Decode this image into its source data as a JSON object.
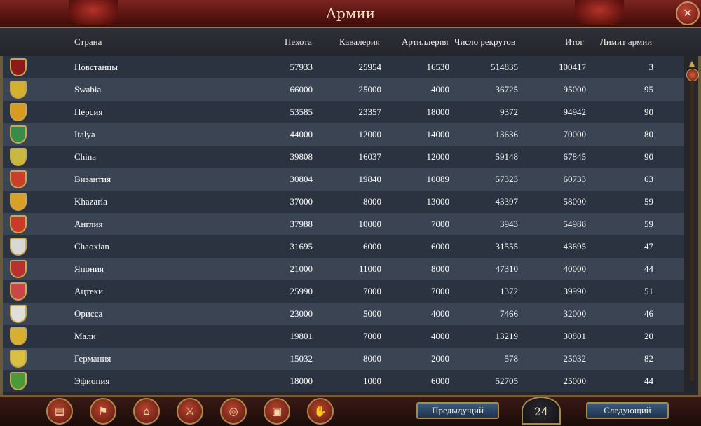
{
  "window": {
    "title": "Армии",
    "close_icon": "✕"
  },
  "columns": {
    "country": "Страна",
    "infantry": "Пехота",
    "cavalry": "Кавалерия",
    "artillery": "Артиллерия",
    "recruits": "Число рекрутов",
    "total": "Итог",
    "army_limit": "Лимит армии"
  },
  "rows": [
    {
      "country": "Повстанцы",
      "infantry": "57933",
      "cavalry": "25954",
      "artillery": "16530",
      "recruits": "514835",
      "total": "100417",
      "army_limit": "3",
      "shield_color": "#8b1a1a"
    },
    {
      "country": "Swabia",
      "infantry": "66000",
      "cavalry": "25000",
      "artillery": "4000",
      "recruits": "36725",
      "total": "95000",
      "army_limit": "95",
      "shield_color": "#d4b030"
    },
    {
      "country": "Персия",
      "infantry": "53585",
      "cavalry": "23357",
      "artillery": "18000",
      "recruits": "9372",
      "total": "94942",
      "army_limit": "90",
      "shield_color": "#d89a20"
    },
    {
      "country": "Italya",
      "infantry": "44000",
      "cavalry": "12000",
      "artillery": "14000",
      "recruits": "13636",
      "total": "70000",
      "army_limit": "80",
      "shield_color": "#3a8a4a"
    },
    {
      "country": "China",
      "infantry": "39808",
      "cavalry": "16037",
      "artillery": "12000",
      "recruits": "59148",
      "total": "67845",
      "army_limit": "90",
      "shield_color": "#c8b840"
    },
    {
      "country": "Византия",
      "infantry": "30804",
      "cavalry": "19840",
      "artillery": "10089",
      "recruits": "57323",
      "total": "60733",
      "army_limit": "63",
      "shield_color": "#c8402a"
    },
    {
      "country": "Khazaria",
      "infantry": "37000",
      "cavalry": "8000",
      "artillery": "13000",
      "recruits": "43397",
      "total": "58000",
      "army_limit": "59",
      "shield_color": "#d8a028"
    },
    {
      "country": "Англия",
      "infantry": "37988",
      "cavalry": "10000",
      "artillery": "7000",
      "recruits": "3943",
      "total": "54988",
      "army_limit": "59",
      "shield_color": "#c83a2a"
    },
    {
      "country": "Chaoxian",
      "infantry": "31695",
      "cavalry": "6000",
      "artillery": "6000",
      "recruits": "31555",
      "total": "43695",
      "army_limit": "47",
      "shield_color": "#d8d8d8"
    },
    {
      "country": "Япония",
      "infantry": "21000",
      "cavalry": "11000",
      "artillery": "8000",
      "recruits": "47310",
      "total": "40000",
      "army_limit": "44",
      "shield_color": "#b83030"
    },
    {
      "country": "Ацтеки",
      "infantry": "25990",
      "cavalry": "7000",
      "artillery": "7000",
      "recruits": "1372",
      "total": "39990",
      "army_limit": "51",
      "shield_color": "#c84848"
    },
    {
      "country": "Орисса",
      "infantry": "23000",
      "cavalry": "5000",
      "artillery": "4000",
      "recruits": "7466",
      "total": "32000",
      "army_limit": "46",
      "shield_color": "#e0e0d8"
    },
    {
      "country": "Мали",
      "infantry": "19801",
      "cavalry": "7000",
      "artillery": "4000",
      "recruits": "13219",
      "total": "30801",
      "army_limit": "20",
      "shield_color": "#d8b030"
    },
    {
      "country": "Германия",
      "infantry": "15032",
      "cavalry": "8000",
      "artillery": "2000",
      "recruits": "578",
      "total": "25032",
      "army_limit": "82",
      "shield_color": "#d8c040"
    },
    {
      "country": "Эфиопия",
      "infantry": "18000",
      "cavalry": "1000",
      "artillery": "6000",
      "recruits": "52705",
      "total": "25000",
      "army_limit": "44",
      "shield_color": "#4a9a3a"
    }
  ],
  "toolbar": {
    "icons": [
      "scroll-icon",
      "flag-icon",
      "buildings-icon",
      "crossed-swords-icon",
      "coins-icon",
      "chest-icon",
      "handshake-icon"
    ],
    "glyphs": [
      "▤",
      "⚑",
      "⌂",
      "⚔",
      "◎",
      "▣",
      "✋"
    ]
  },
  "pagination": {
    "prev_label": "Предыдущий",
    "page": "24",
    "next_label": "Следующий"
  },
  "scroll_up_glyph": "▲"
}
